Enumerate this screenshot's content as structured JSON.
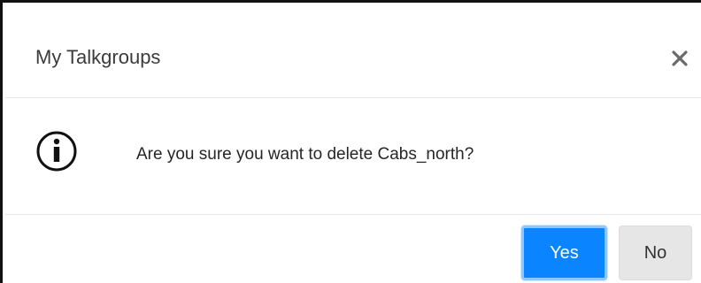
{
  "dialog": {
    "title": "My Talkgroups",
    "message": "Are you sure you want to delete Cabs_north?",
    "icons": {
      "close": "close-icon",
      "info": "info-icon"
    },
    "buttons": {
      "yes_label": "Yes",
      "no_label": "No"
    },
    "colors": {
      "primary": "#0a84ff",
      "secondary": "#e6e6e6"
    }
  }
}
